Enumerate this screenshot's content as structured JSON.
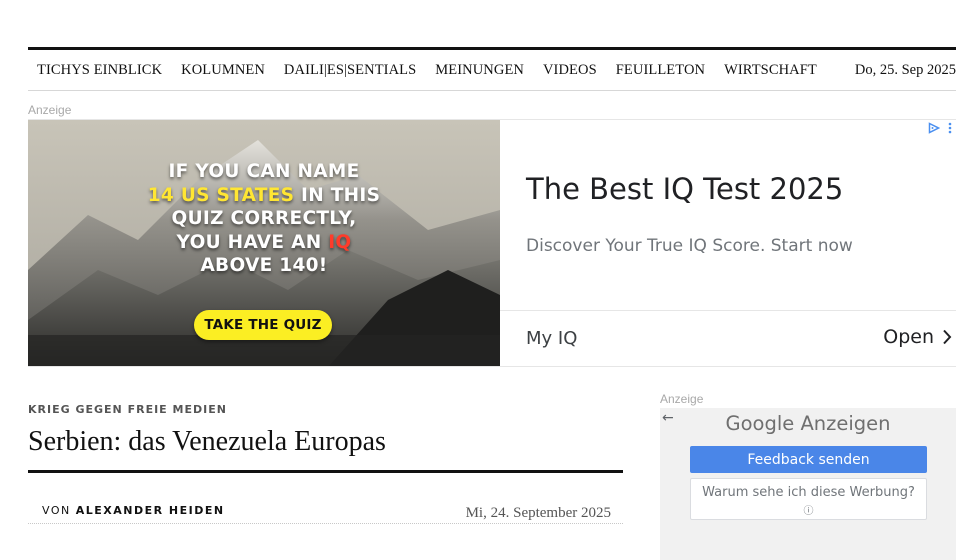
{
  "nav": {
    "items": [
      "TICHYS EINBLICK",
      "KOLUMNEN",
      "DAILI|ES|SENTIALS",
      "MEINUNGEN",
      "VIDEOS",
      "FEUILLETON",
      "WIRTSCHAFT"
    ],
    "date": "Do, 25. Sep 2025"
  },
  "ad_label": "Anzeige",
  "banner_ad": {
    "headline_1": "IF YOU CAN NAME",
    "headline_2_highlight": "14 US STATES",
    "headline_2_rest": " IN THIS",
    "headline_3": "QUIZ CORRECTLY,",
    "headline_4_pre": "YOU HAVE AN ",
    "headline_4_highlight": "IQ",
    "headline_5": "ABOVE 140!",
    "cta": "TAKE THE QUIZ",
    "title": "The Best IQ Test 2025",
    "description": "Discover Your True IQ Score. Start now",
    "brand": "My IQ",
    "open_label": "Open",
    "icons": [
      "adchoices-icon",
      "more-vert-icon",
      "chevron-right-icon"
    ]
  },
  "article": {
    "kicker": "KRIEG GEGEN FREIE MEDIEN",
    "headline": "Serbien: das Venezuela Europas",
    "byline_prefix": "VON",
    "author": "ALEXANDER HEIDEN",
    "date": "Mi, 24. September 2025"
  },
  "sidebar_ad": {
    "label": "Anzeige",
    "google": "Google",
    "anzeigen": "Anzeigen",
    "feedback_button": "Feedback senden",
    "why_button": "Warum sehe ich diese Werbung?",
    "info_symbol": "ⓘ"
  },
  "colors": {
    "feedback_blue": "#4a86e8",
    "cta_yellow": "#fbee23",
    "highlight_yellow": "#ffe633",
    "highlight_red": "#ff3b2a"
  }
}
